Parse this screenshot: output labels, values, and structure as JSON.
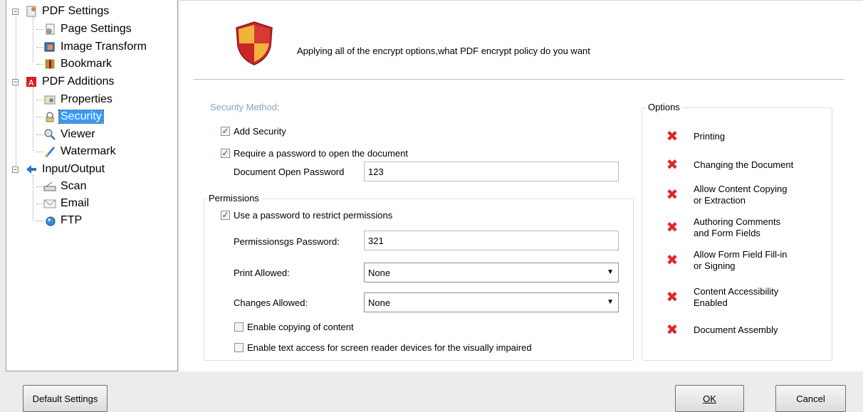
{
  "sidebar": {
    "items": [
      {
        "label": "PDF Settings",
        "icon": "pdf-settings-icon",
        "level": 0
      },
      {
        "label": "Page Settings",
        "icon": "page-settings-icon",
        "level": 1
      },
      {
        "label": "Image Transform",
        "icon": "image-transform-icon",
        "level": 1
      },
      {
        "label": "Bookmark",
        "icon": "bookmark-icon",
        "level": 1
      },
      {
        "label": "PDF Additions",
        "icon": "pdf-additions-icon",
        "level": 0
      },
      {
        "label": "Properties",
        "icon": "properties-icon",
        "level": 1
      },
      {
        "label": "Security",
        "icon": "security-icon",
        "level": 1,
        "selected": true
      },
      {
        "label": "Viewer",
        "icon": "viewer-icon",
        "level": 1
      },
      {
        "label": "Watermark",
        "icon": "watermark-icon",
        "level": 1
      },
      {
        "label": "Input/Output",
        "icon": "input-output-icon",
        "level": 0
      },
      {
        "label": "Scan",
        "icon": "scan-icon",
        "level": 1
      },
      {
        "label": "Email",
        "icon": "email-icon",
        "level": 1
      },
      {
        "label": "FTP",
        "icon": "ftp-icon",
        "level": 1
      }
    ]
  },
  "header": {
    "text": "Applying all of the encrypt options,what PDF encrypt policy do you want"
  },
  "security": {
    "method_label": "Security Method:",
    "add_security": {
      "label": "Add Security",
      "checked": true
    },
    "require_password": {
      "label": "Require a password to open the document",
      "checked": true
    },
    "open_password_label": "Document Open Password",
    "open_password_value": "123"
  },
  "permissions": {
    "title": "Permissions",
    "use_password": {
      "label": "Use a password to restrict permissions",
      "checked": true
    },
    "password_label": "Permissionsgs Password:",
    "password_value": "321",
    "print_label": "Print Allowed:",
    "print_value": "None",
    "changes_label": "Changes Allowed:",
    "changes_value": "None",
    "enable_copying": {
      "label": "Enable copying of content",
      "checked": false
    },
    "enable_text_access": {
      "label": "Enable text access for screen reader devices for the visually impaired",
      "checked": false
    }
  },
  "options": {
    "title": "Options",
    "items": [
      "Printing",
      "Changing the Document",
      "Allow Content Copying\nor Extraction",
      "Authoring Comments\nand Form Fields",
      "Allow Form Field Fill-in\nor Signing",
      "Content Accessibility\nEnabled",
      "Document Assembly"
    ]
  },
  "buttons": {
    "default_settings": "Default Settings",
    "ok": "OK",
    "cancel": "Cancel"
  },
  "colors": {
    "selection": "#3399ff",
    "disabled_x": "#e0262b",
    "muted_text": "#8aa3b8"
  }
}
